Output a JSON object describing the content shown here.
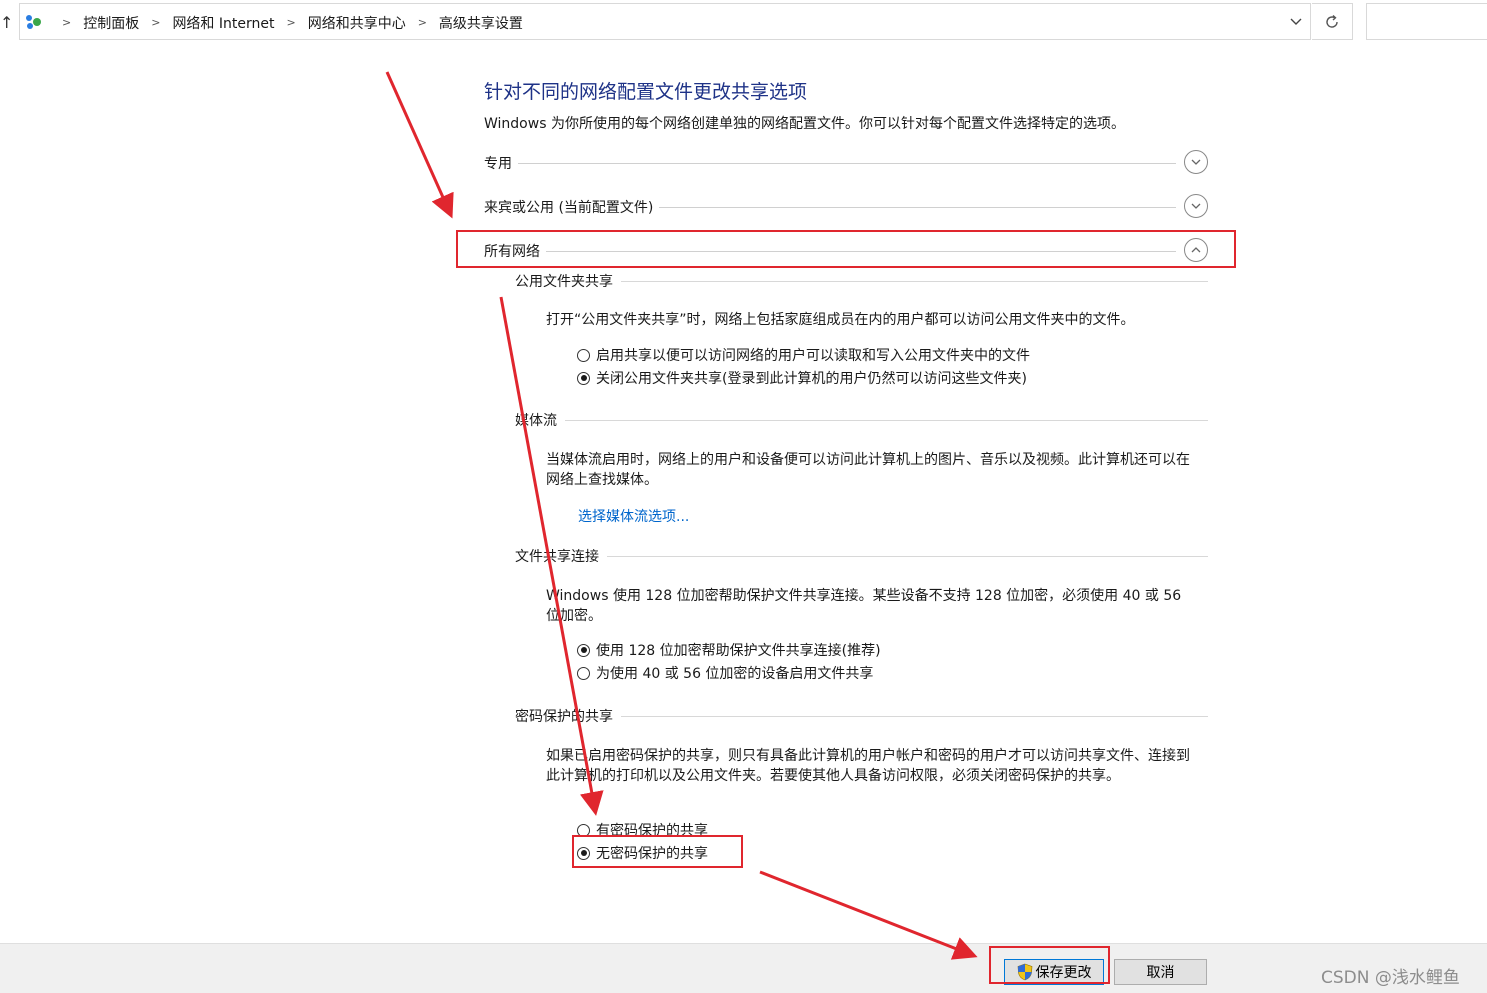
{
  "address_bar": {
    "breadcrumbs": [
      "控制面板",
      "网络和 Internet",
      "网络和共享中心",
      "高级共享设置"
    ]
  },
  "page": {
    "title": "针对不同的网络配置文件更改共享选项",
    "description": "Windows 为你所使用的每个网络创建单独的网络配置文件。你可以针对每个配置文件选择特定的选项。"
  },
  "profiles": [
    {
      "label": "专用",
      "expanded": false
    },
    {
      "label": "来宾或公用 (当前配置文件)",
      "expanded": false
    },
    {
      "label": "所有网络",
      "expanded": true
    }
  ],
  "sections": {
    "public_folder": {
      "heading": "公用文件夹共享",
      "text": "打开“公用文件夹共享”时，网络上包括家庭组成员在内的用户都可以访问公用文件夹中的文件。",
      "options": [
        {
          "label": "启用共享以便可以访问网络的用户可以读取和写入公用文件夹中的文件",
          "checked": false
        },
        {
          "label": "关闭公用文件夹共享(登录到此计算机的用户仍然可以访问这些文件夹)",
          "checked": true
        }
      ]
    },
    "media": {
      "heading": "媒体流",
      "text": "当媒体流启用时，网络上的用户和设备便可以访问此计算机上的图片、音乐以及视频。此计算机还可以在网络上查找媒体。",
      "link": "选择媒体流选项..."
    },
    "file_sharing": {
      "heading": "文件共享连接",
      "text": "Windows 使用 128 位加密帮助保护文件共享连接。某些设备不支持 128 位加密，必须使用 40 或 56 位加密。",
      "options": [
        {
          "label": "使用 128 位加密帮助保护文件共享连接(推荐)",
          "checked": true
        },
        {
          "label": "为使用 40 或 56 位加密的设备启用文件共享",
          "checked": false
        }
      ]
    },
    "password": {
      "heading": "密码保护的共享",
      "text": "如果已启用密码保护的共享，则只有具备此计算机的用户帐户和密码的用户才可以访问共享文件、连接到此计算机的打印机以及公用文件夹。若要使其他人具备访问权限，必须关闭密码保护的共享。",
      "options": [
        {
          "label": "有密码保护的共享",
          "checked": false
        },
        {
          "label": "无密码保护的共享",
          "checked": true
        }
      ]
    }
  },
  "footer": {
    "save_label": "保存更改",
    "cancel_label": "取消"
  },
  "watermark": "CSDN @浅水鲤鱼",
  "colors": {
    "title": "#1e3287",
    "link": "#0066cc",
    "annotation_red": "#e0262e"
  }
}
